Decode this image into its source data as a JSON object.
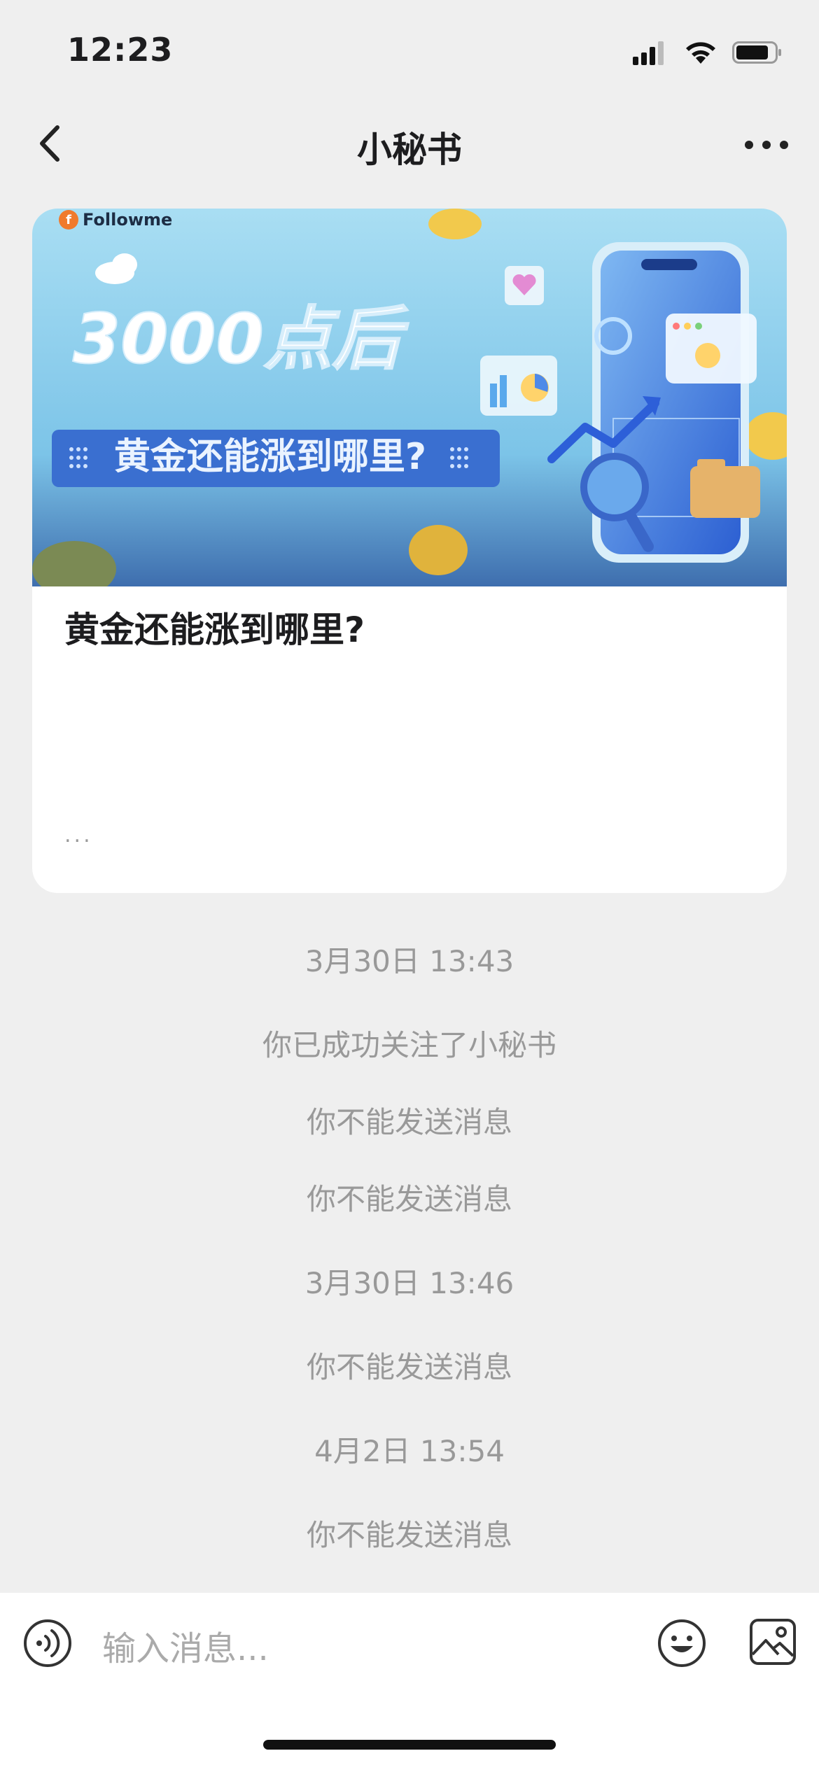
{
  "status_bar": {
    "time": "12:23"
  },
  "nav": {
    "title": "小秘书"
  },
  "article": {
    "brand": "Followme",
    "banner_headline": "3000点后",
    "banner_subheadline": "黄金还能涨到哪里?",
    "title": "黄金还能涨到哪里?",
    "ellipsis": "..."
  },
  "messages": [
    {
      "type": "timestamp",
      "text": "3月30日 13:43"
    },
    {
      "type": "system",
      "text": "你已成功关注了小秘书"
    },
    {
      "type": "system",
      "text": "你不能发送消息"
    },
    {
      "type": "system",
      "text": "你不能发送消息"
    },
    {
      "type": "timestamp",
      "text": "3月30日 13:46"
    },
    {
      "type": "system",
      "text": "你不能发送消息"
    },
    {
      "type": "timestamp",
      "text": "4月2日 13:54"
    },
    {
      "type": "system",
      "text": "你不能发送消息"
    }
  ],
  "input": {
    "placeholder": "输入消息..."
  },
  "icons": [
    "signal-icon",
    "wifi-icon",
    "battery-icon",
    "back-arrow-icon",
    "more-icon",
    "voice-icon",
    "emoji-icon",
    "image-icon"
  ],
  "colors": {
    "background": "#efefef",
    "system_text": "#999999",
    "banner_bg": "#8fd0ee",
    "banner_label": "#3a6fd0"
  }
}
